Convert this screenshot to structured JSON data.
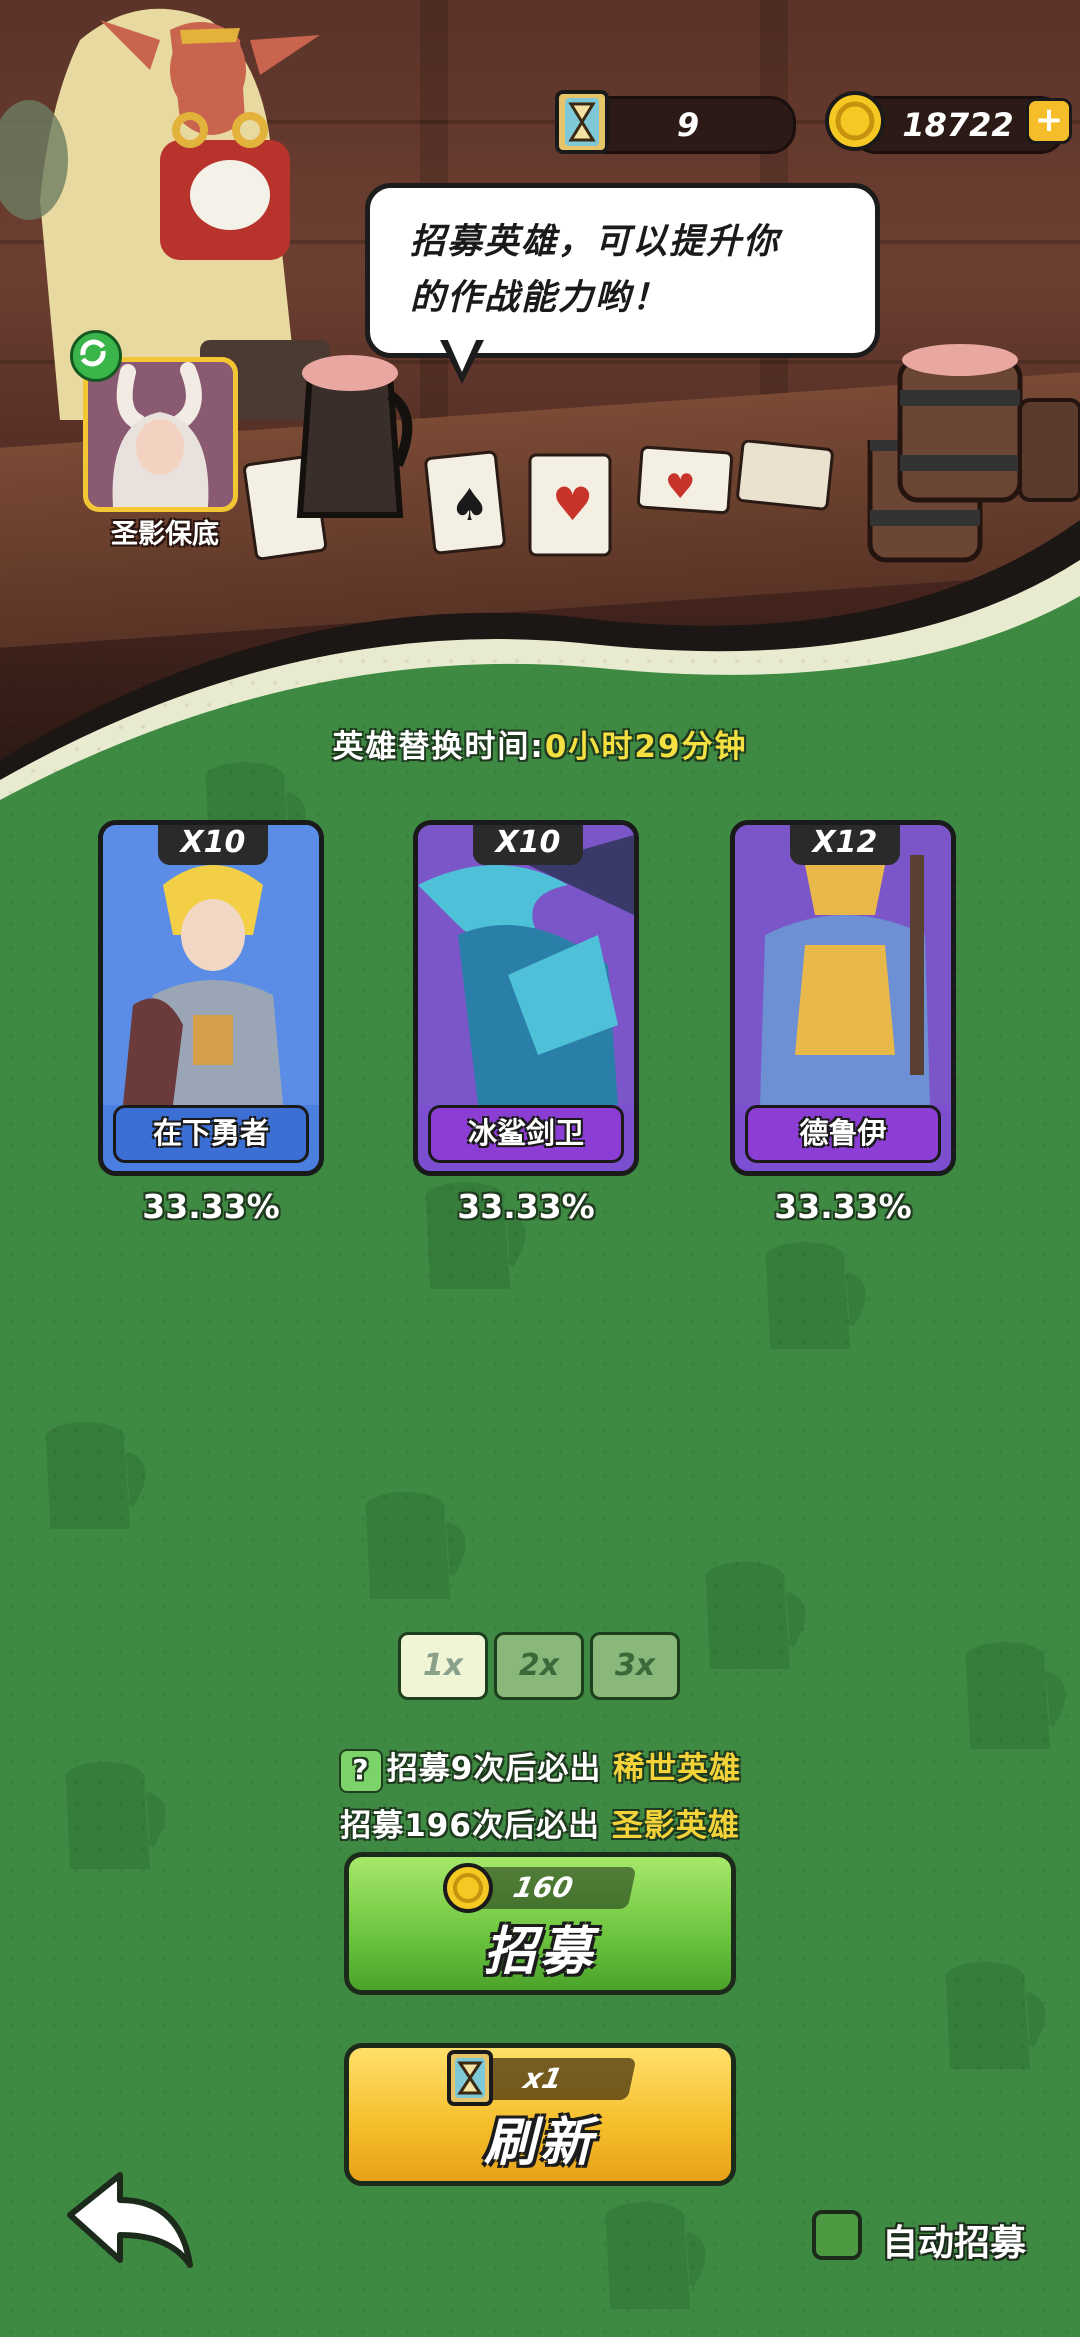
{
  "resources": {
    "hourglass_count": "9",
    "gold_count": "18722",
    "add_label": "+"
  },
  "dialog": {
    "speech_line1": "招募英雄，可以提升你",
    "speech_line2": "的作战能力哟！"
  },
  "guarantee": {
    "label": "圣影保底"
  },
  "timer": {
    "label": "英雄替换时间:",
    "value": "0小时29分钟"
  },
  "heroes": [
    {
      "qty": "X10",
      "name": "在下勇者",
      "chance": "33.33%"
    },
    {
      "qty": "X10",
      "name": "冰鲨剑卫",
      "chance": "33.33%"
    },
    {
      "qty": "X12",
      "name": "德鲁伊",
      "chance": "33.33%"
    }
  ],
  "multipliers": [
    "1x",
    "2x",
    "3x"
  ],
  "selected_multiplier": "1x",
  "pity": {
    "qmark": "?",
    "line1_prefix": "招募9次后必出",
    "line1_highlight": "稀世英雄",
    "line2_prefix": "招募196次后必出",
    "line2_highlight": "圣影英雄"
  },
  "recruit": {
    "cost": "160",
    "label": "招募"
  },
  "refresh": {
    "cost": "x1",
    "label": "刷新"
  },
  "auto_recruit": {
    "label": "自动招募",
    "checked": false
  },
  "colors": {
    "felt_green": "#3f8a43",
    "highlight_yellow": "#f3d23a",
    "recruit_green": "#6cc43e",
    "refresh_yellow": "#f5bd2a"
  }
}
